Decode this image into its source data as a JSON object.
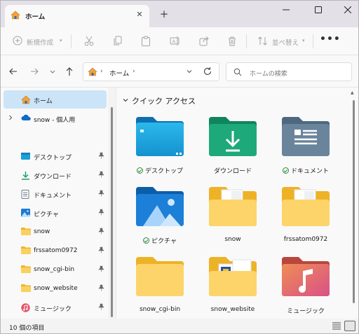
{
  "tab": {
    "title": "ホーム",
    "close": "✕",
    "add": "+"
  },
  "toolbar": {
    "new_label": "新規作成",
    "sort_label": "並べ替え",
    "more": "•••"
  },
  "address": {
    "gt": "›",
    "path": "ホーム",
    "dropdown": "⌄"
  },
  "search": {
    "placeholder": "ホームの検索"
  },
  "sidebar": {
    "items": [
      {
        "label": "ホーム",
        "icon": "home-icon"
      },
      {
        "label": "snow - 個人用",
        "icon": "onedrive-icon"
      },
      {
        "label": "デスクトップ",
        "icon": "desktop-icon"
      },
      {
        "label": "ダウンロード",
        "icon": "download-icon"
      },
      {
        "label": "ドキュメント",
        "icon": "document-icon"
      },
      {
        "label": "ピクチャ",
        "icon": "pictures-icon"
      },
      {
        "label": "snow",
        "icon": "folder-icon"
      },
      {
        "label": "frssatom0972",
        "icon": "folder-icon"
      },
      {
        "label": "snow_cgi-bin",
        "icon": "folder-icon"
      },
      {
        "label": "snow_website",
        "icon": "folder-icon"
      },
      {
        "label": "ミュージック",
        "icon": "music-icon"
      }
    ]
  },
  "main": {
    "section_title": "クイック アクセス",
    "tiles": [
      {
        "label": "デスクトップ",
        "synced": true
      },
      {
        "label": "ダウンロード",
        "synced": false
      },
      {
        "label": "ドキュメント",
        "synced": true
      },
      {
        "label": "ピクチャ",
        "synced": true
      },
      {
        "label": "snow",
        "synced": false
      },
      {
        "label": "frssatom0972",
        "synced": false
      },
      {
        "label": "snow_cgi-bin",
        "synced": false
      },
      {
        "label": "snow_website",
        "synced": false
      },
      {
        "label": "ミュージック",
        "synced": false
      }
    ]
  },
  "status": {
    "count_text": "10 個の項目"
  },
  "colors": {
    "accent": "#0067c0",
    "selected": "#cce4f7",
    "folder_yellow": "#f8c944",
    "sync_green": "#2e8b3a"
  }
}
